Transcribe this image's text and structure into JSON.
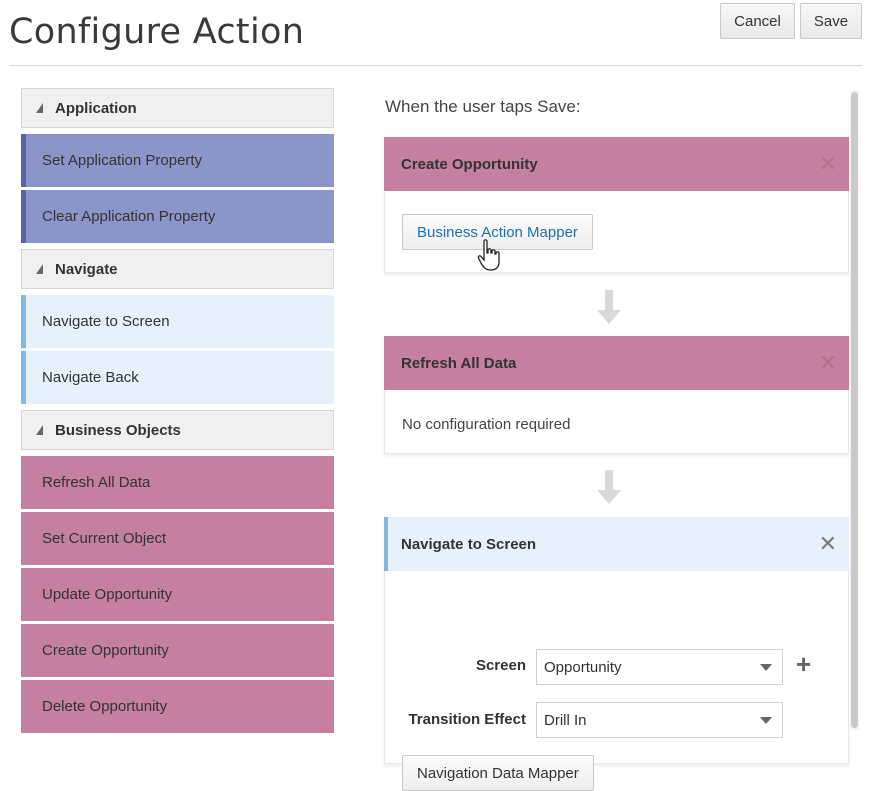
{
  "header": {
    "title": "Configure Action",
    "cancel_label": "Cancel",
    "save_label": "Save"
  },
  "palette": {
    "application": {
      "label": "Application",
      "items": [
        "Set Application Property",
        "Clear Application Property"
      ]
    },
    "navigate": {
      "label": "Navigate",
      "items": [
        "Navigate to Screen",
        "Navigate Back"
      ]
    },
    "business_objects": {
      "label": "Business Objects",
      "items": [
        "Refresh All Data",
        "Set Current Object",
        "Update Opportunity",
        "Create Opportunity",
        "Delete Opportunity"
      ]
    }
  },
  "flow": {
    "trigger_text": "When the user taps Save:",
    "steps": [
      {
        "title": "Create Opportunity",
        "button_label": "Business Action Mapper"
      },
      {
        "title": "Refresh All Data",
        "message": "No configuration required"
      },
      {
        "title": "Navigate to Screen",
        "screen_label": "Screen",
        "screen_value": "Opportunity",
        "transition_label": "Transition Effect",
        "transition_value": "Drill In",
        "button_label": "Navigation Data Mapper"
      }
    ]
  },
  "colors": {
    "application": "#8c95c9",
    "navigate": "#e6f1fb",
    "business_objects": "#c57fa0"
  },
  "icons": [
    "collapse-triangle-icon",
    "close-icon",
    "down-arrow-icon",
    "caret-down-icon",
    "plus-icon",
    "hand-cursor-icon"
  ]
}
